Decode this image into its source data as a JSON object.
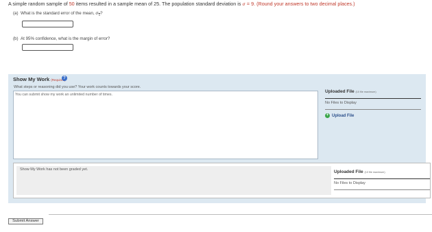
{
  "intro": {
    "prefix": "A simple random sample of ",
    "n": "50",
    "middle": " items resulted in a sample mean of 25. The population standard deviation is ",
    "sigma_symbol": "σ",
    "sigma_value": " = 9. (Round your answers to two decimal places.)"
  },
  "questions": [
    {
      "label": "(a)",
      "text": "What is the standard error of the mean, ",
      "symbol": "σ",
      "subscript": "x",
      "suffix": "?"
    },
    {
      "label": "(b)",
      "text": "At 95% confidence, what is the margin of error?"
    }
  ],
  "show_my_work": {
    "title": "Show My Work",
    "required": "(Required)",
    "help_icon": "?",
    "subtitle": "What steps or reasoning did you use? Your work counts towards your score.",
    "placeholder": "You can submit show my work an unlimited number of times.",
    "graded_text": "Show My Work has not been graded yet."
  },
  "uploads": {
    "heading": "Uploaded File",
    "max_note": "(10 file maximum)",
    "none_text": "No Files to Display",
    "upload_button": "Upload File",
    "upload_icon": "plus-circle-icon"
  },
  "submit": {
    "label": "Submit Answer"
  },
  "colors": {
    "highlight": "#c0392b",
    "panel": "#dce8f1",
    "help": "#3b6fc9",
    "upload_plus": "#3aa64a"
  }
}
